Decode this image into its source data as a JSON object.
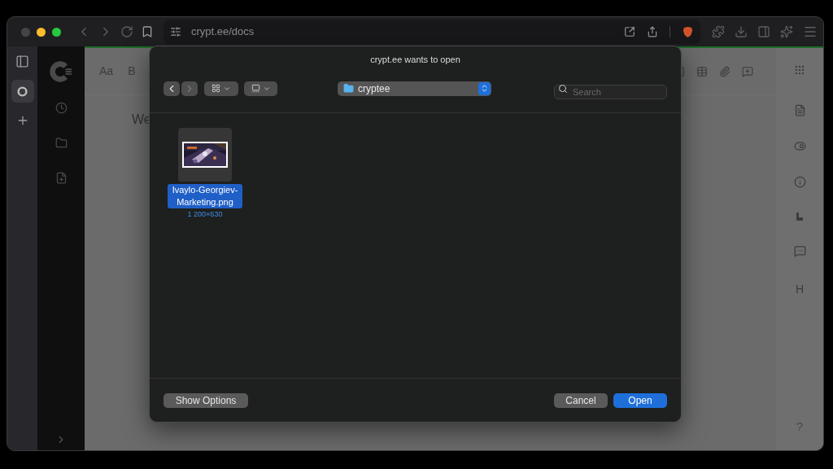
{
  "browser": {
    "url": "crypt.ee/docs"
  },
  "editor": {
    "format_buttons": [
      "Aa",
      "B"
    ],
    "body_text": "We",
    "side_heading": "H",
    "help": "?"
  },
  "dialog": {
    "title": "crypt.ee wants to open",
    "location": "cryptee",
    "search": {
      "placeholder": "Search"
    },
    "files": [
      {
        "name": "Ivaylo-Georgiev-Marketing.png",
        "dimensions": "1 200×630",
        "selected": true
      }
    ],
    "buttons": [
      {
        "label": "Show Options",
        "kind": "secondary"
      },
      {
        "label": "Cancel",
        "kind": "secondary"
      },
      {
        "label": "Open",
        "kind": "primary"
      }
    ]
  }
}
